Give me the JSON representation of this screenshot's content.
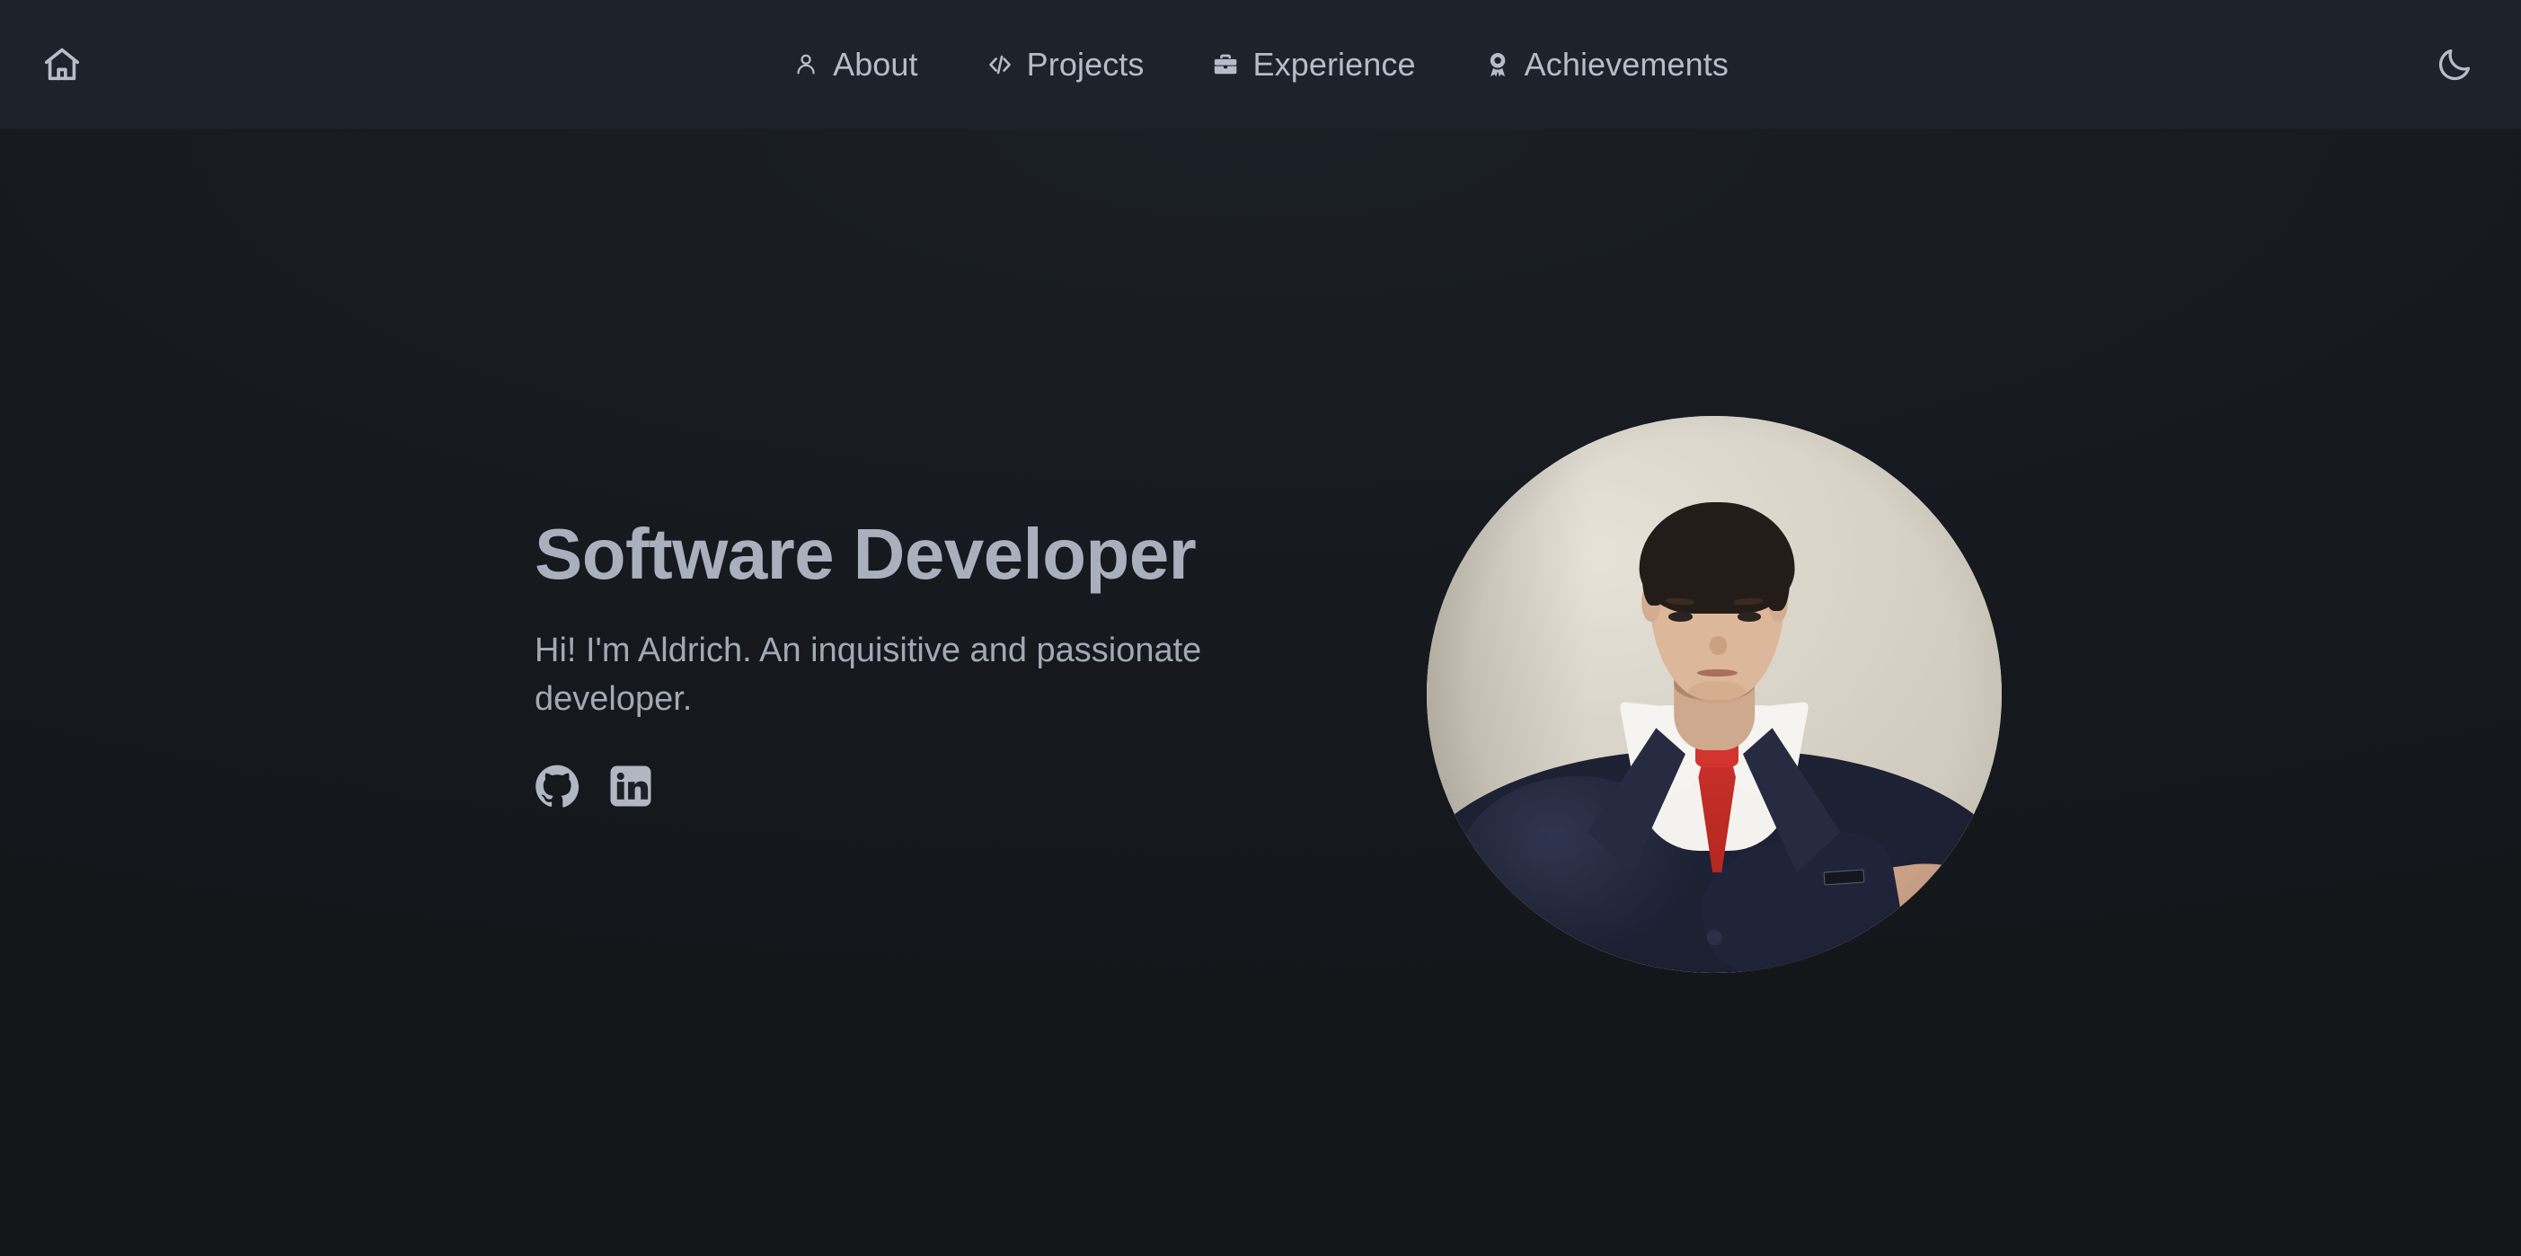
{
  "theme": {
    "navbar_bg": "#1e222b",
    "page_bg": "#15181d",
    "text_color": "#aeb4c0",
    "heading_color": "#a9afbd",
    "photo_bg": "#dcd7cc",
    "blazer_color": "#1d2134",
    "tie_color": "#c9302c"
  },
  "navbar": {
    "home_icon": "home-icon",
    "theme_toggle_icon": "moon-icon",
    "links": [
      {
        "label": "About",
        "icon": "user-icon"
      },
      {
        "label": "Projects",
        "icon": "code-icon",
        "glyph": "</>"
      },
      {
        "label": "Experience",
        "icon": "briefcase-icon"
      },
      {
        "label": "Achievements",
        "icon": "award-icon"
      }
    ]
  },
  "hero": {
    "title": "Software Developer",
    "subtitle": "Hi! I'm Aldrich. An inquisitive and passionate developer.",
    "socials": [
      {
        "label": "GitHub",
        "icon": "github-icon"
      },
      {
        "label": "LinkedIn",
        "icon": "linkedin-icon"
      }
    ],
    "portrait": {
      "alt": "Portrait of Aldrich in a navy blazer, white shirt and red tie",
      "shape": "circle"
    }
  }
}
